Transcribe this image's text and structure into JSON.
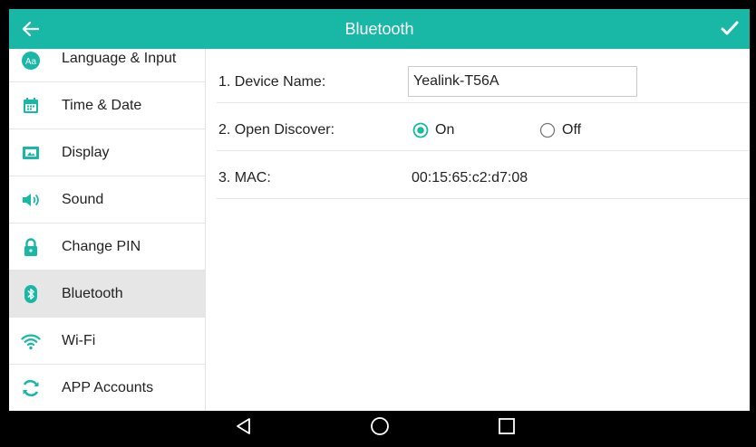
{
  "header": {
    "title": "Bluetooth"
  },
  "sidebar": {
    "items": [
      {
        "label": "Language & Input",
        "icon": "language-icon"
      },
      {
        "label": "Time & Date",
        "icon": "calendar-icon"
      },
      {
        "label": "Display",
        "icon": "display-icon"
      },
      {
        "label": "Sound",
        "icon": "speaker-icon"
      },
      {
        "label": "Change PIN",
        "icon": "lock-icon"
      },
      {
        "label": "Bluetooth",
        "icon": "bluetooth-icon",
        "active": true
      },
      {
        "label": "Wi-Fi",
        "icon": "wifi-icon"
      },
      {
        "label": "APP Accounts",
        "icon": "sync-icon"
      }
    ]
  },
  "settings": {
    "device_name": {
      "label": "1. Device Name:",
      "value": "Yealink-T56A"
    },
    "open_discover": {
      "label": "2. Open Discover:",
      "on": "On",
      "off": "Off",
      "selected": "On"
    },
    "mac": {
      "label": "3. MAC:",
      "value": "00:15:65:c2:d7:08"
    }
  },
  "colors": {
    "accent": "#19b8a6",
    "active_row": "#e6e6e6"
  },
  "icon_glyphs": {
    "language_icon_text": "Aa"
  }
}
